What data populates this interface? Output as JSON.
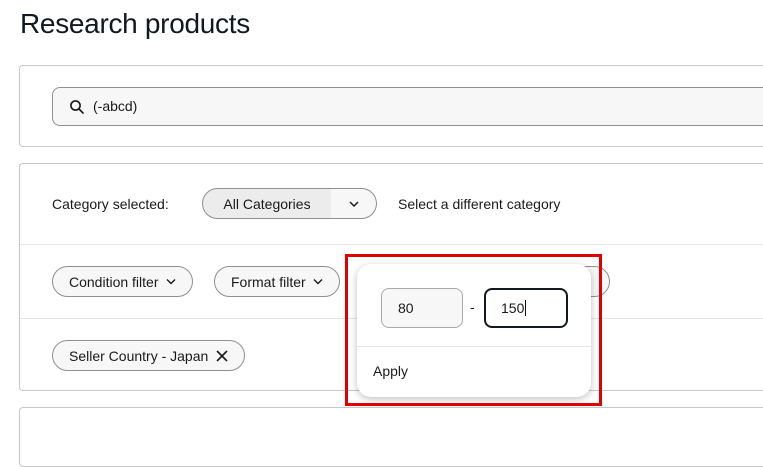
{
  "page": {
    "title": "Research products"
  },
  "search": {
    "value": "(-abcd)",
    "icon": "search-icon"
  },
  "category": {
    "label": "Category selected:",
    "selected": "All Categories",
    "change_link": "Select a different category"
  },
  "filters": [
    {
      "label": "Condition filter"
    },
    {
      "label": "Format filter"
    }
  ],
  "applied_filters": [
    {
      "label": "Seller Country - Japan"
    }
  ],
  "price_popover": {
    "min_value": "80",
    "separator": "-",
    "max_value": "150",
    "apply_label": "Apply"
  },
  "colors": {
    "highlight": "#e00000",
    "text": "#191919",
    "border": "#8f8f8f"
  }
}
